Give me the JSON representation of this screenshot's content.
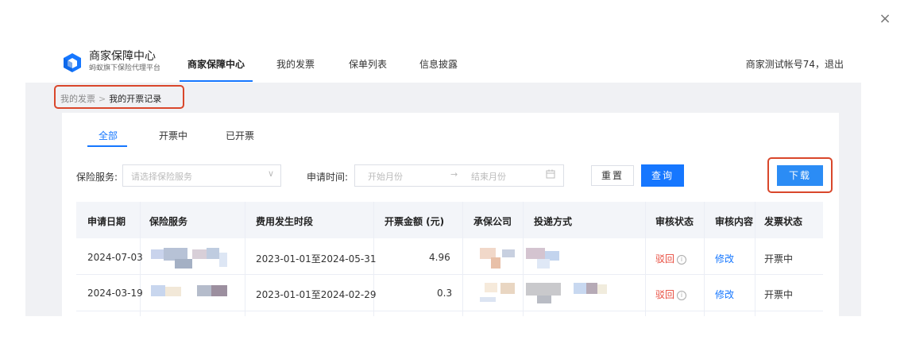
{
  "window": {
    "close_label": "×"
  },
  "header": {
    "brand_title": "商家保障中心",
    "brand_subtitle": "蚂蚁旗下保险代理平台",
    "nav": [
      "商家保障中心",
      "我的发票",
      "保单列表",
      "信息披露"
    ],
    "account_text": "商家测试帐号74，退出"
  },
  "breadcrumb": {
    "parent": "我的发票",
    "separator": ">",
    "current": "我的开票记录"
  },
  "tabs": [
    "全部",
    "开票中",
    "已开票"
  ],
  "filters": {
    "service_label": "保险服务:",
    "service_placeholder": "请选择保险服务",
    "time_label": "申请时间:",
    "start_placeholder": "开始月份",
    "range_arrow": "→",
    "end_placeholder": "结束月份",
    "reset_label": "重置",
    "query_label": "查询",
    "download_label": "下载"
  },
  "table": {
    "columns": [
      "申请日期",
      "保险服务",
      "费用发生时段",
      "开票金额 (元)",
      "承保公司",
      "投递方式",
      "审核状态",
      "审核内容",
      "发票状态"
    ],
    "rows": [
      {
        "date": "2024-07-03",
        "period": "2023-01-01至2024-05-31",
        "amount": "4.96",
        "review_status": "驳回",
        "review_content": "修改",
        "invoice_status": "开票中"
      },
      {
        "date": "2024-03-19",
        "period": "2023-01-01至2024-02-29",
        "amount": "0.3",
        "review_status": "驳回",
        "review_content": "修改",
        "invoice_status": "开票中"
      }
    ]
  },
  "colors": {
    "accent": "#1677ff",
    "highlight_border": "#d9472b",
    "reject": "#e84a3c"
  }
}
